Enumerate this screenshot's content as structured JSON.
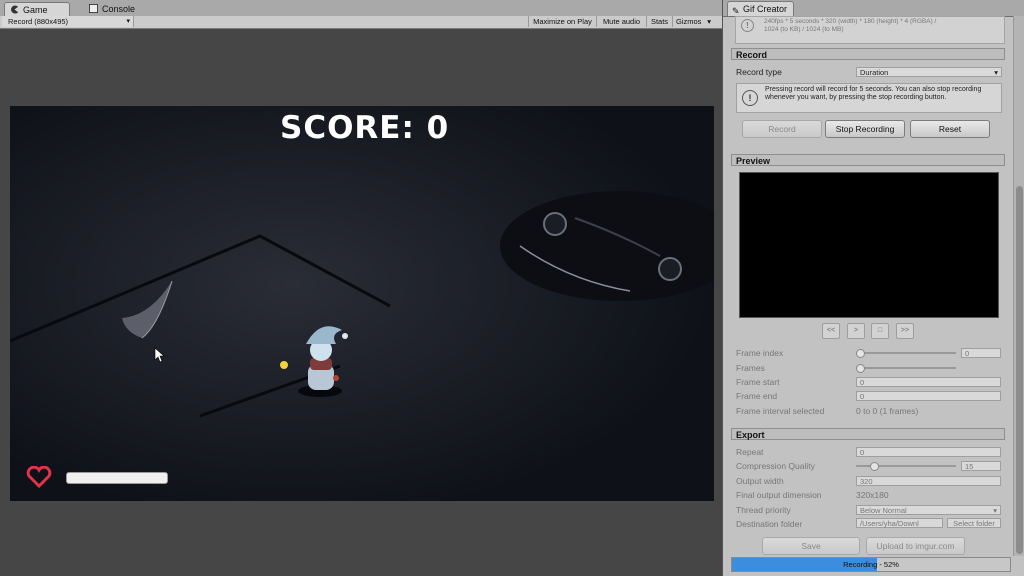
{
  "game": {
    "tabs": [
      {
        "label": "Game",
        "icon": "pacman-icon"
      },
      {
        "label": "Console",
        "icon": "console-icon"
      }
    ],
    "resolution": "Record (880x495)",
    "toolbar": {
      "maximize": "Maximize on Play",
      "mute": "Mute audio",
      "stats": "Stats",
      "gizmos": "Gizmos"
    },
    "score": "SCORE: 0",
    "health": 1.0
  },
  "gif": {
    "tab": "Gif Creator",
    "info_line1": "240fps * 5 seconds * 320 (width) * 180 (height) * 4 (RGBA) /",
    "info_line2": "1024 (to KB) / 1024 (to MB)",
    "record": {
      "header": "Record",
      "type_label": "Record type",
      "type_value": "Duration",
      "help": "Pressing record will record for 5 seconds. You can also stop recording whenever you want, by pressing the stop recording button.",
      "record_btn": "Record",
      "stop_btn": "Stop Recording",
      "reset_btn": "Reset"
    },
    "preview": {
      "header": "Preview",
      "playback": [
        "<<",
        ">",
        "□",
        ">>"
      ],
      "frame_index_label": "Frame index",
      "frame_index_value": "0",
      "frames_label": "Frames",
      "frame_start_label": "Frame start",
      "frame_start_value": "0",
      "frame_end_label": "Frame end",
      "frame_end_value": "0",
      "interval_label": "Frame interval selected",
      "interval_value": "0 to 0 (1 frames)"
    },
    "export": {
      "header": "Export",
      "repeat_label": "Repeat",
      "repeat_value": "0",
      "quality_label": "Compression Quality",
      "quality_value": "15",
      "width_label": "Output width",
      "width_value": "320",
      "final_label": "Final output dimension",
      "final_value": "320x180",
      "thread_label": "Thread priority",
      "thread_value": "Below Normal",
      "dest_label": "Destination folder",
      "dest_value": "/Users/yha/Downl",
      "select_folder": "Select folder",
      "save_btn": "Save",
      "upload_btn": "Upload to imgur.com"
    },
    "progress": {
      "label": "Recording - 52%",
      "value": 0.52
    }
  },
  "colors": {
    "progress_fill": "#3c8dde",
    "viewport_bg": "#11141c",
    "panel_bg": "#c2c2c2"
  }
}
